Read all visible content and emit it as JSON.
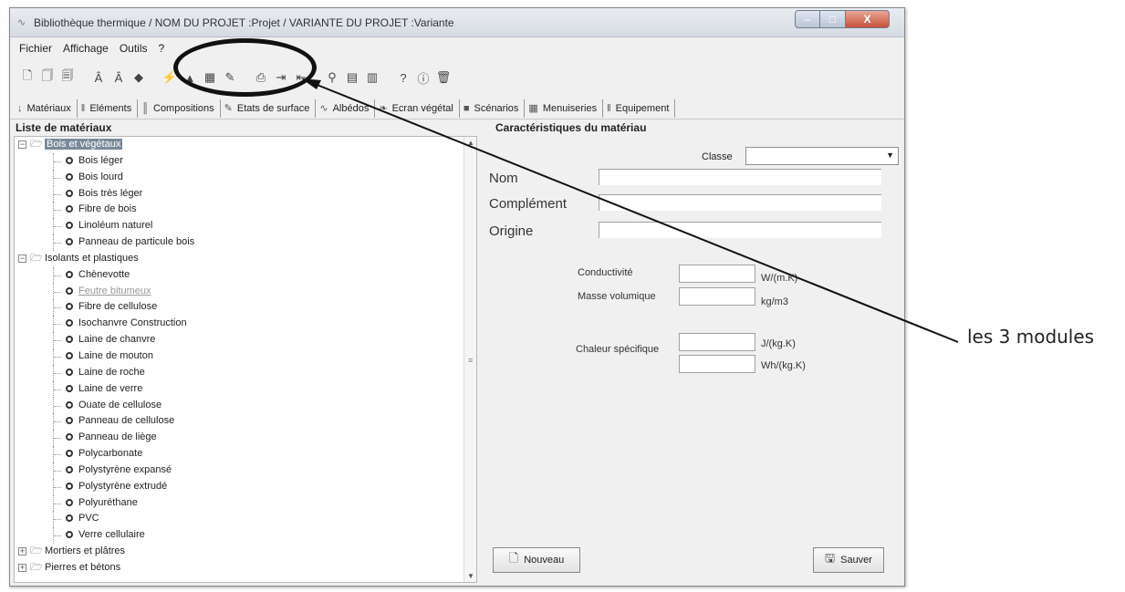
{
  "window": {
    "title": "Bibliothèque thermique / NOM DU PROJET :Projet / VARIANTE DU PROJET :Variante",
    "buttons": {
      "minimize": "–",
      "maximize": "□",
      "close": "X"
    }
  },
  "menu": [
    "Fichier",
    "Affichage",
    "Outils",
    "?"
  ],
  "toolbar": {
    "icons": [
      "new-doc-icon",
      "copy-doc-icon",
      "paste-doc-icon",
      "font-a-icon",
      "font-b-icon",
      "eraser-icon",
      "module-1-icon",
      "module-2-icon",
      "module-3-icon",
      "module-4-icon",
      "print-icon",
      "export-icon",
      "import-icon",
      "search-icon",
      "filter-icon",
      "chart-icon",
      "help-icon",
      "info-icon",
      "trash-icon"
    ]
  },
  "tabs": [
    {
      "label": "Matériaux",
      "icon": "thermometer-icon"
    },
    {
      "label": "Eléments",
      "icon": "element-icon"
    },
    {
      "label": "Compositions",
      "icon": "composition-icon"
    },
    {
      "label": "Etats de surface",
      "icon": "surface-icon"
    },
    {
      "label": "Albédos",
      "icon": "albedo-icon"
    },
    {
      "label": "Ecran végétal",
      "icon": "plant-icon"
    },
    {
      "label": "Scénarios",
      "icon": "scenario-icon"
    },
    {
      "label": "Menuiseries",
      "icon": "window-icon"
    },
    {
      "label": "Equipement",
      "icon": "equipment-icon"
    }
  ],
  "left_panel": {
    "title": "Liste de matériaux",
    "tree": [
      {
        "type": "cat",
        "expander": "−",
        "label": "Bois et végétaux",
        "selected": true
      },
      {
        "type": "leaf",
        "label": "Bois léger"
      },
      {
        "type": "leaf",
        "label": "Bois lourd"
      },
      {
        "type": "leaf",
        "label": "Bois très léger"
      },
      {
        "type": "leaf",
        "label": "Fibre de bois"
      },
      {
        "type": "leaf",
        "label": "Linoléum naturel"
      },
      {
        "type": "leaf",
        "label": "Panneau de particule bois"
      },
      {
        "type": "cat",
        "expander": "−",
        "label": "Isolants et plastiques"
      },
      {
        "type": "leaf",
        "label": "Chènevotte"
      },
      {
        "type": "leaf",
        "label": "Feutre bitumeux",
        "disabled": true
      },
      {
        "type": "leaf",
        "label": "Fibre de cellulose"
      },
      {
        "type": "leaf",
        "label": "Isochanvre Construction"
      },
      {
        "type": "leaf",
        "label": "Laine de chanvre"
      },
      {
        "type": "leaf",
        "label": "Laine de mouton"
      },
      {
        "type": "leaf",
        "label": "Laine de roche"
      },
      {
        "type": "leaf",
        "label": "Laine de verre"
      },
      {
        "type": "leaf",
        "label": "Ouate de cellulose"
      },
      {
        "type": "leaf",
        "label": "Panneau de cellulose"
      },
      {
        "type": "leaf",
        "label": "Panneau de liège"
      },
      {
        "type": "leaf",
        "label": "Polycarbonate"
      },
      {
        "type": "leaf",
        "label": "Polystyrène expansé"
      },
      {
        "type": "leaf",
        "label": "Polystyrène extrudé"
      },
      {
        "type": "leaf",
        "label": "Polyuréthane"
      },
      {
        "type": "leaf",
        "label": "PVC"
      },
      {
        "type": "leaf",
        "label": "Verre cellulaire"
      },
      {
        "type": "cat",
        "expander": "+",
        "label": "Mortiers et plâtres"
      },
      {
        "type": "cat",
        "expander": "+",
        "label": "Pierres et bétons"
      }
    ]
  },
  "right_panel": {
    "title": "Caractéristiques du matériau",
    "classe_label": "Classe",
    "classe_value": "",
    "nom_label": "Nom",
    "complement_label": "Complément",
    "origine_label": "Origine",
    "conductivite_label": "Conductivité",
    "conductivite_unit": "W/(m.K)",
    "masse_label": "Masse volumique",
    "masse_unit": "kg/m3",
    "chaleur_label": "Chaleur spécifique",
    "chaleur_unit1": "J/(kg.K)",
    "chaleur_unit2": "Wh/(kg.K)",
    "nouveau_label": "Nouveau",
    "sauver_label": "Sauver"
  },
  "annotation": {
    "text": "les 3 modules"
  }
}
